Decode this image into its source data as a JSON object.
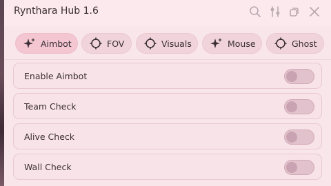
{
  "window": {
    "title": "Rynthara Hub 1.6",
    "controls": [
      "search-icon",
      "sliders-icon",
      "restore-icon",
      "close-icon"
    ]
  },
  "tabs": [
    {
      "label": "Aimbot",
      "icon": "sparkle-icon",
      "active": true
    },
    {
      "label": "FOV",
      "icon": "crosshair-icon",
      "active": false
    },
    {
      "label": "Visuals",
      "icon": "crosshair-icon",
      "active": false
    },
    {
      "label": "Mouse",
      "icon": "sparkle-icon",
      "active": false
    },
    {
      "label": "Ghost",
      "icon": "crosshair-icon",
      "active": false
    }
  ],
  "settings": [
    {
      "label": "Enable Aimbot",
      "enabled": false
    },
    {
      "label": "Team Check",
      "enabled": false
    },
    {
      "label": "Alive Check",
      "enabled": false
    },
    {
      "label": "Wall Check",
      "enabled": false
    }
  ],
  "colors": {
    "accent": "#f3c6d2",
    "background": "#f9e6ea",
    "toggle_off": "#e2c2cc",
    "text": "#3a2f35"
  }
}
